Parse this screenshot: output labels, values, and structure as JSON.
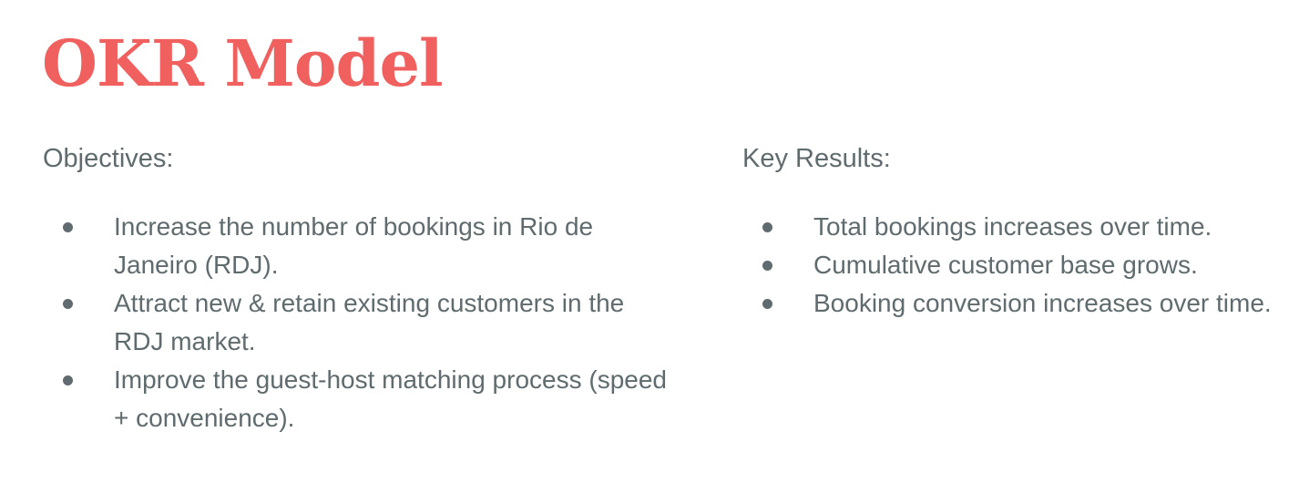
{
  "title": "OKR Model",
  "objectives": {
    "heading": "Objectives:",
    "items": [
      "Increase the number of bookings in Rio de Janeiro (RDJ).",
      "Attract new & retain existing customers in the RDJ market.",
      "Improve the guest-host matching process (speed + convenience)."
    ]
  },
  "key_results": {
    "heading": "Key Results:",
    "items": [
      "Total bookings increases over time.",
      "Cumulative customer base grows.",
      "Booking conversion increases over time."
    ]
  }
}
